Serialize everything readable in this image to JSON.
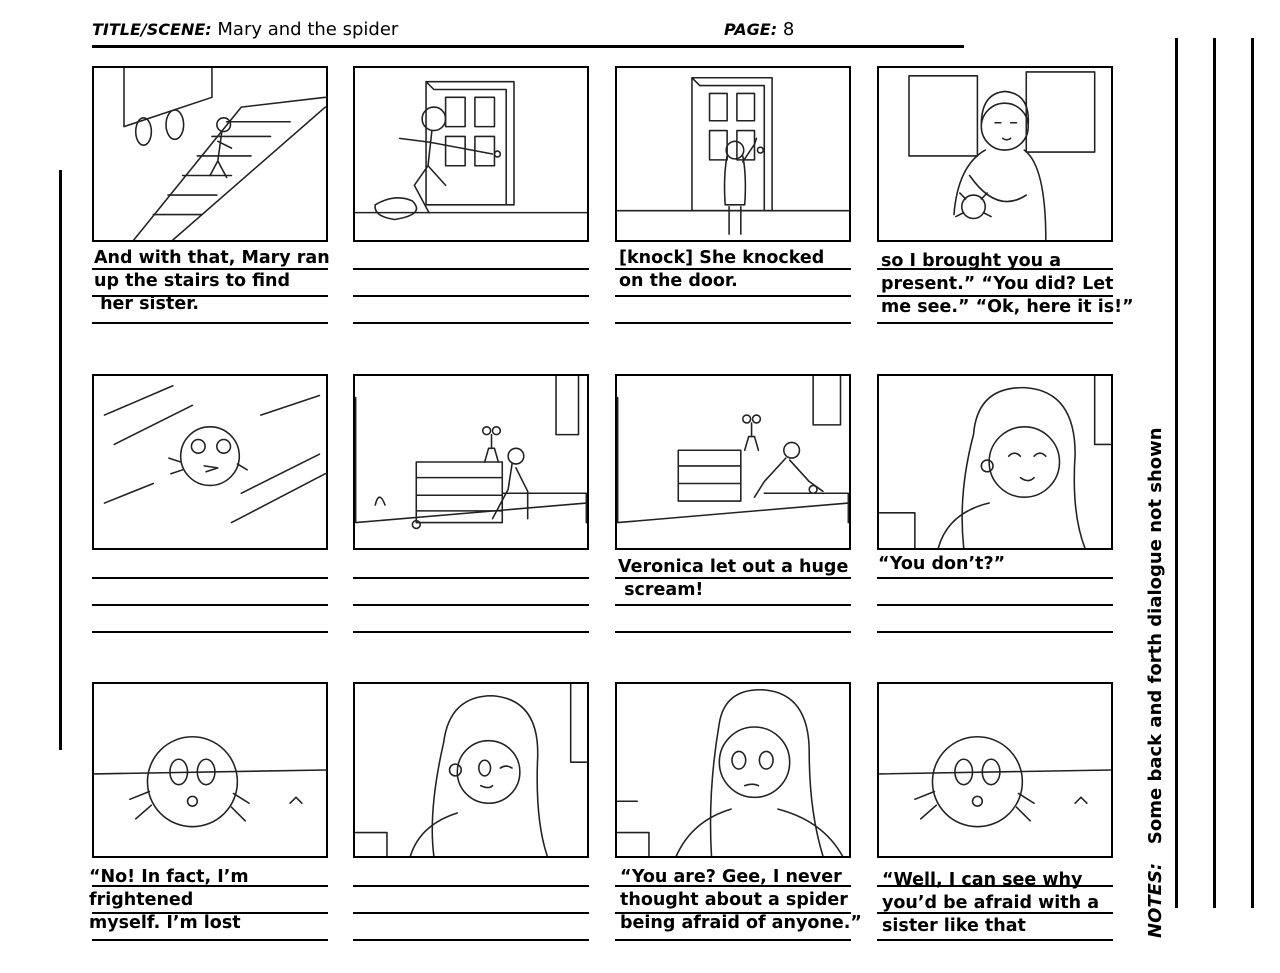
{
  "header": {
    "title_label": "TITLE/SCENE:",
    "title_value": "Mary and the spider",
    "page_label": "PAGE:",
    "page_value": "8"
  },
  "notes": {
    "label": "NOTES:",
    "text": "Some back and forth dialogue not shown"
  },
  "panels": [
    {
      "caption": "And with that, Mary ran\nup the stairs to find\n her sister."
    },
    {
      "caption": ""
    },
    {
      "caption": "[knock] She knocked\non the door."
    },
    {
      "caption": "so I brought you a\npresent.” “You did? Let\nme see.” “Ok, here it is!”"
    },
    {
      "caption": ""
    },
    {
      "caption": ""
    },
    {
      "caption": "Veronica let out a huge\n scream!"
    },
    {
      "caption": "“You don’t?”"
    },
    {
      "caption": "“No! In fact, I’m\nfrightened\nmyself. I’m lost"
    },
    {
      "caption": ""
    },
    {
      "caption": "“You are? Gee, I never\nthought about a spider\nbeing afraid of anyone.”"
    },
    {
      "caption": "“Well, I can see why\nyou’d be afraid with a\nsister like that"
    }
  ]
}
